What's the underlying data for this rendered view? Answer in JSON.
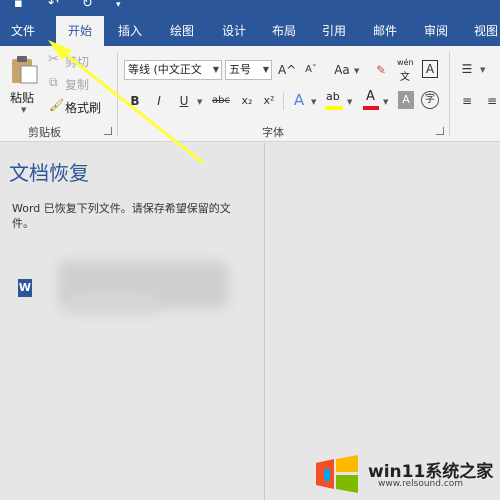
{
  "tabs": [
    "文件",
    "开始",
    "插入",
    "绘图",
    "设计",
    "布局",
    "引用",
    "邮件",
    "审阅",
    "视图"
  ],
  "active_tab_index": 1,
  "clipboard": {
    "paste_label": "粘贴",
    "cut_label": "剪切",
    "copy_label": "复制",
    "format_painter_label": "格式刷",
    "group_label": "剪贴板"
  },
  "font": {
    "font_name": "等线 (中文正文",
    "font_size": "五号",
    "grow_icon": "A^",
    "shrink_icon": "Aˇ",
    "case_label": "Aa",
    "phonetic_top": "wén",
    "phonetic_bottom": "文",
    "border_char": "A",
    "bold": "B",
    "italic": "I",
    "underline": "U",
    "strike": "abc",
    "subscript": "x₂",
    "superscript": "x²",
    "effect": "A",
    "highlight": "ab",
    "font_color": "A",
    "shading": "A",
    "enclose": "字",
    "group_label": "字体"
  },
  "recovery": {
    "title": "文档恢复",
    "description": "Word 已恢复下列文件。请保存希望保留的文件。",
    "word_icon_letter": "W"
  },
  "watermark": {
    "text": "win11系统之家",
    "url": "www.relsound.com"
  },
  "colors": {
    "brand_blue": "#2b579a",
    "highlight_yellow": "#ffff00",
    "font_red": "#e81123",
    "arrow_yellow": "#ffff33"
  }
}
